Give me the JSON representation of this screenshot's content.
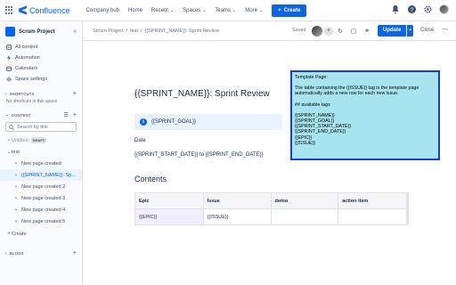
{
  "topnav": {
    "logo_text": "Confluence",
    "items": [
      {
        "label": "Company hub",
        "chevron": false
      },
      {
        "label": "Home",
        "chevron": false
      },
      {
        "label": "Recent",
        "chevron": true
      },
      {
        "label": "Spaces",
        "chevron": true
      },
      {
        "label": "Teams",
        "chevron": true
      },
      {
        "label": "More",
        "chevron": true
      }
    ],
    "create_label": "Create",
    "right_icons": [
      "notifications-icon",
      "help-icon",
      "settings-icon"
    ]
  },
  "sidebar": {
    "space_name": "Scrum Project",
    "links": [
      {
        "label": "All content",
        "icon": "all-content-icon"
      },
      {
        "label": "Automation",
        "icon": "automation-icon"
      },
      {
        "label": "Calendars",
        "icon": "calendar-icon"
      },
      {
        "label": "Space settings",
        "icon": "settings-icon"
      }
    ],
    "shortcuts_heading": "SHORTCUTS",
    "no_shortcuts": "No shortcuts in this space",
    "content_heading": "CONTENT",
    "search_placeholder": "Search by title",
    "untitled": "Untitled",
    "draft_badge": "DRAFT",
    "tree_parent": "test",
    "tree_items": [
      {
        "label": "New page created",
        "active": false
      },
      {
        "label": "{{SPRINT_NAME}}: Sp...",
        "active": true
      },
      {
        "label": "New page created 2",
        "active": false
      },
      {
        "label": "New page created 3",
        "active": false
      },
      {
        "label": "New page created 4",
        "active": false
      },
      {
        "label": "New page created 5",
        "active": false
      }
    ],
    "create_label": "Create",
    "blogs_heading": "BLOGS"
  },
  "editor_header": {
    "breadcrumb": [
      "Scrum Project",
      "/",
      "test",
      "/",
      "{{SPRINT_NAME}}: Sprint Review"
    ],
    "saved": "Saved",
    "update_label": "Update",
    "close_label": "Close"
  },
  "page": {
    "title": "{{SPRINT_NAME}}: Sprint Review",
    "panel_text": "{{SPRINT_GOAL}}",
    "date_label": "Date",
    "date_value": "{{SPRINT_START_DATE}}  to {{SPRINT_END_DATE}}",
    "contents_heading": "Contents",
    "table": {
      "headers": [
        "Epic",
        "Issue",
        "demo",
        "action item"
      ],
      "rows": [
        [
          "{{EPIC}}",
          "{{ISSUE}}",
          "",
          ""
        ]
      ]
    }
  },
  "template_box": {
    "lines": [
      "Template Page:",
      "",
      "The table containing the {{ISSUE}} tag in the template page automatically adds a new row for each new issue.",
      "",
      "## available tags",
      "",
      "{{SPRINT_NAME}}",
      "{{SPRINT_GOAL}}",
      "{{SPRINT_START_DATE}}",
      "{{SPRINT_END_DATE}}",
      "{{EPIC}}",
      "{{ISSUE}}"
    ]
  }
}
